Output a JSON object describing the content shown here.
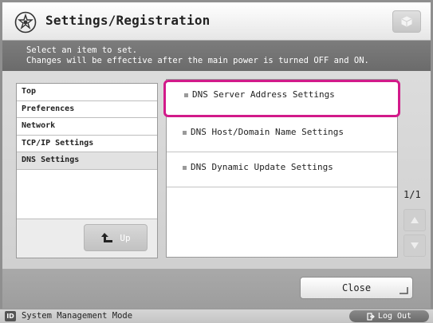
{
  "header": {
    "title": "Settings/Registration"
  },
  "instructions": {
    "line1": "Select an item to set.",
    "line2": "Changes will be effective after the main power is turned OFF and ON."
  },
  "breadcrumb": {
    "items": [
      "Top",
      "Preferences",
      "Network",
      "TCP/IP Settings",
      "DNS Settings"
    ],
    "up_label": "Up"
  },
  "list": {
    "items": [
      "DNS Server Address Settings",
      "DNS Host/Domain Name Settings",
      "DNS Dynamic Update Settings"
    ],
    "selected_index": 0
  },
  "pager": {
    "indicator": "1/1"
  },
  "footer": {
    "close_label": "Close"
  },
  "status": {
    "id_badge": "ID",
    "mode": "System Management Mode",
    "logout_label": "Log Out"
  },
  "colors": {
    "selection": "#d21a8a"
  }
}
